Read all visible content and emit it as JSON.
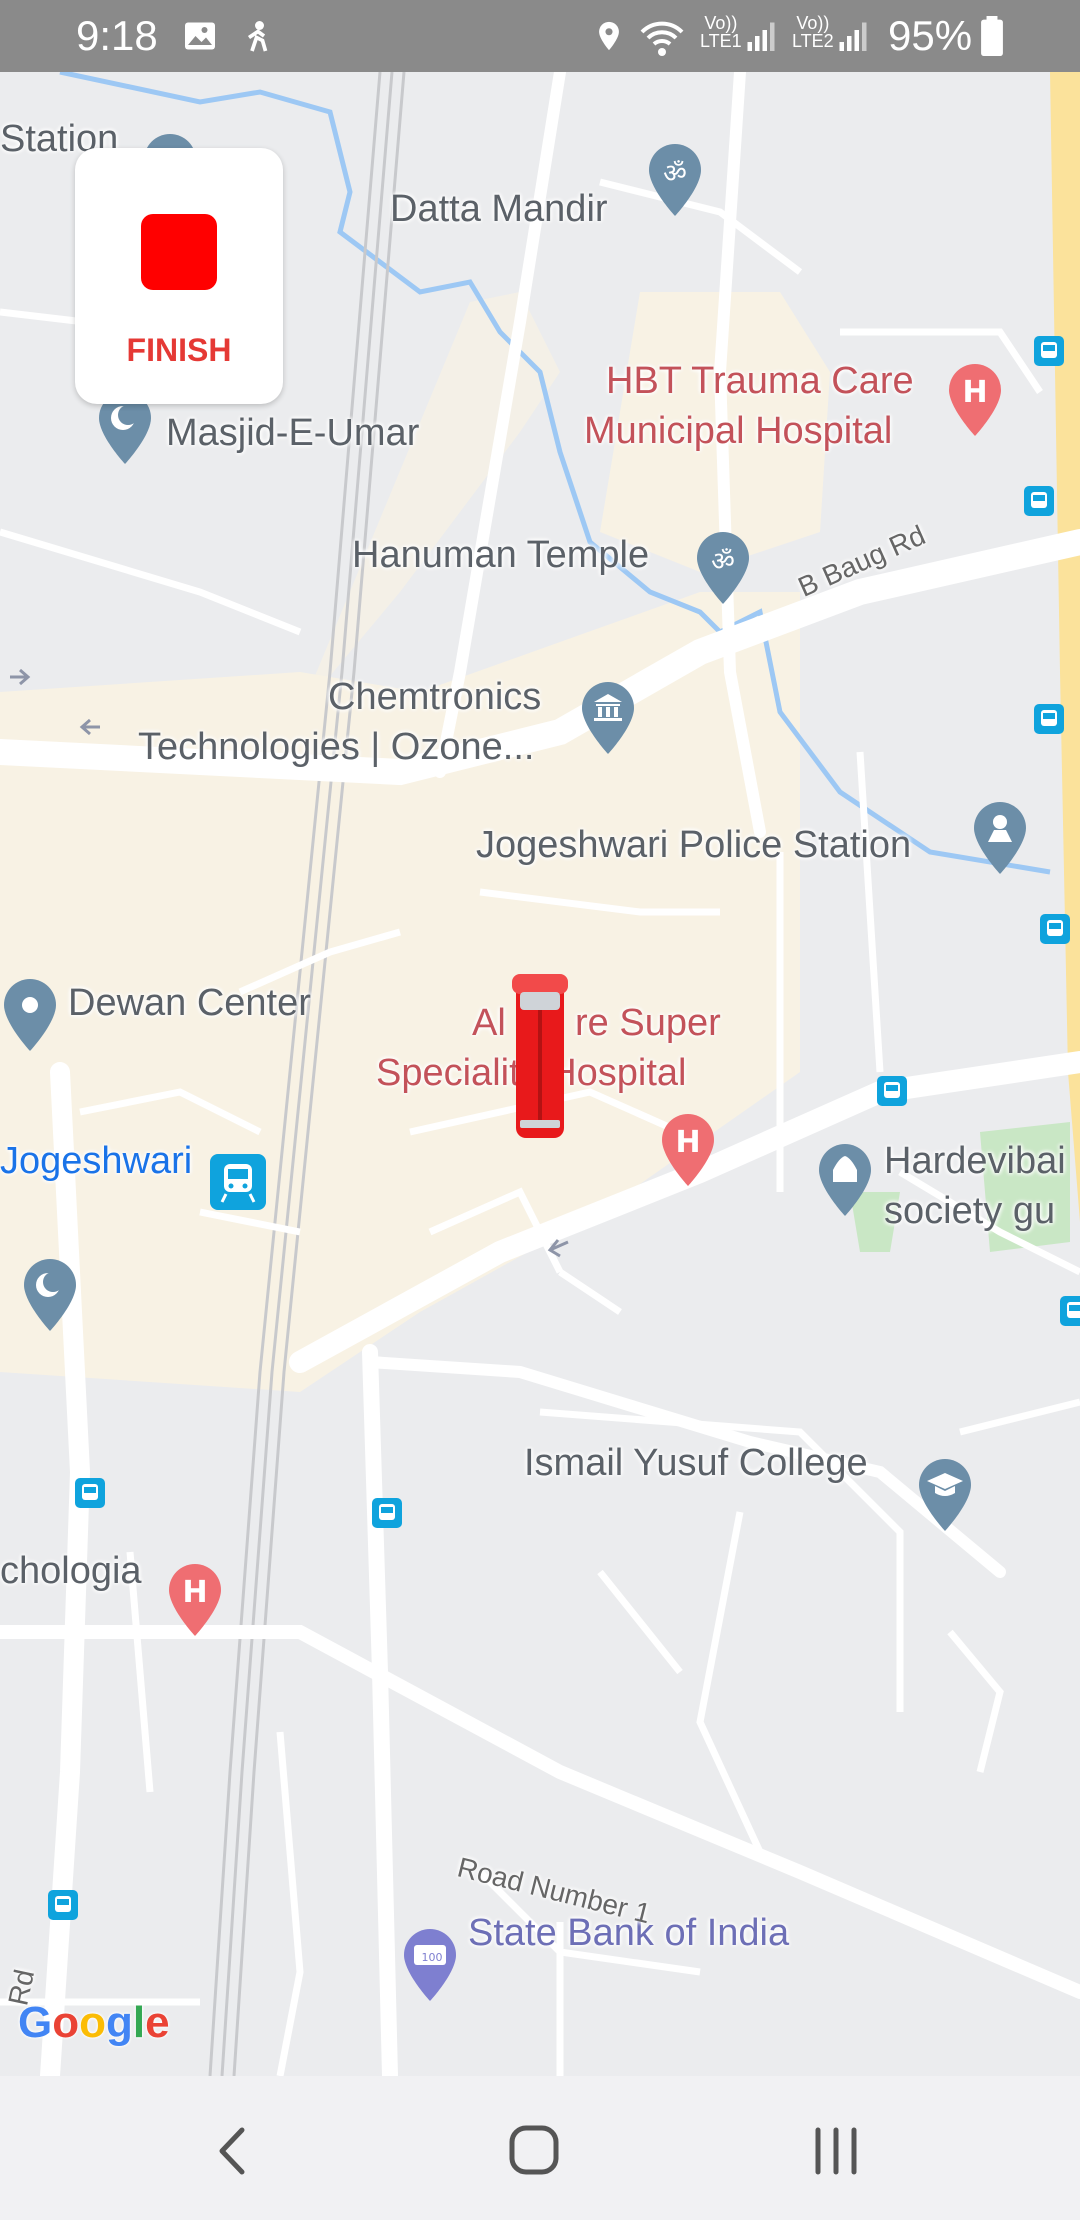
{
  "status_bar": {
    "time": "9:18",
    "battery_percent": "95%",
    "network_1": "LTE1",
    "network_2": "LTE2",
    "icons": [
      "gallery-icon",
      "figure-icon",
      "location-icon",
      "wifi-icon",
      "signal-icon",
      "signal-icon",
      "battery-icon"
    ]
  },
  "finish_button": {
    "label": "FINISH",
    "color": "#ff0000"
  },
  "map": {
    "places": [
      {
        "name": "Station",
        "type": "transit"
      },
      {
        "name": "Datta Mandir",
        "type": "temple"
      },
      {
        "name": "HBT Trauma Care",
        "name_line2": "Municipal Hospital",
        "type": "hospital"
      },
      {
        "name": "Masjid-E-Umar",
        "type": "mosque"
      },
      {
        "name": "Hanuman Temple",
        "type": "temple"
      },
      {
        "name": "Chemtronics",
        "name_line2": "Technologies | Ozone...",
        "type": "institution"
      },
      {
        "name": "Jogeshwari Police Station",
        "type": "police"
      },
      {
        "name": "Dewan Center",
        "type": "place"
      },
      {
        "name": "Al",
        "name_mid": "re Super",
        "name_line2": "Speciality Hospital",
        "type": "hospital"
      },
      {
        "name": "Jogeshwari",
        "type": "railway-station"
      },
      {
        "name": "Hardevibai",
        "name_line2": "society gu",
        "type": "religious"
      },
      {
        "name": "Ismail Yusuf College",
        "type": "college"
      },
      {
        "name": "chologia",
        "type": "hospital"
      },
      {
        "name": "State Bank of India",
        "type": "bank"
      }
    ],
    "roads": [
      "B Baug Rd",
      "Road Number 1",
      "Rd"
    ],
    "colors": {
      "background": "#ebecee",
      "highlight_area": "#f8f2e4",
      "road": "#ffffff",
      "water": "#9dc8f4",
      "highway": "#fbe29b",
      "hospital_pin": "#ef6e72",
      "place_pin": "#6c8ea8",
      "transit_icon": "#0fa3dd"
    }
  },
  "logo": "Google",
  "nav_bar": {
    "back": "back-icon",
    "home": "home-icon",
    "recents": "recents-icon"
  }
}
